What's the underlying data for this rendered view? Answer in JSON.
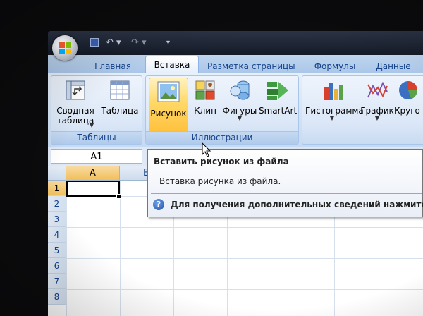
{
  "quick_access": {
    "save_icon": "save-icon",
    "undo_icon": "undo-icon",
    "redo_icon": "redo-icon",
    "customize_icon": "customize-qat-icon"
  },
  "tabs": [
    {
      "label": "Главная",
      "active": false
    },
    {
      "label": "Вставка",
      "active": true
    },
    {
      "label": "Разметка страницы",
      "active": false
    },
    {
      "label": "Формулы",
      "active": false
    },
    {
      "label": "Данные",
      "active": false
    }
  ],
  "ribbon": {
    "tables_group": {
      "label": "Таблицы",
      "pivot_line1": "Сводная",
      "pivot_line2": "таблица",
      "table": "Таблица"
    },
    "illustrations_group": {
      "label": "Иллюстрации",
      "picture": "Рисунок",
      "clip": "Клип",
      "shapes": "Фигуры",
      "smartart": "SmartArt"
    },
    "charts_group": {
      "histogram": "Гистограмма",
      "graph": "График",
      "pie": "Круго"
    }
  },
  "name_box": "A1",
  "grid": {
    "columns": [
      "A",
      "B"
    ],
    "rows": [
      "1",
      "2",
      "3",
      "4",
      "5",
      "6",
      "7",
      "8"
    ],
    "active_cell": "A1"
  },
  "tooltip": {
    "title": "Вставить рисунок из файла",
    "body": "Вставка рисунка из файла.",
    "help": "Для получения дополнительных сведений нажмите кла"
  },
  "colors": {
    "ribbon_text": "#15428b",
    "hot_button": "#ffd868",
    "tab_strip": "#bfd5ee"
  }
}
